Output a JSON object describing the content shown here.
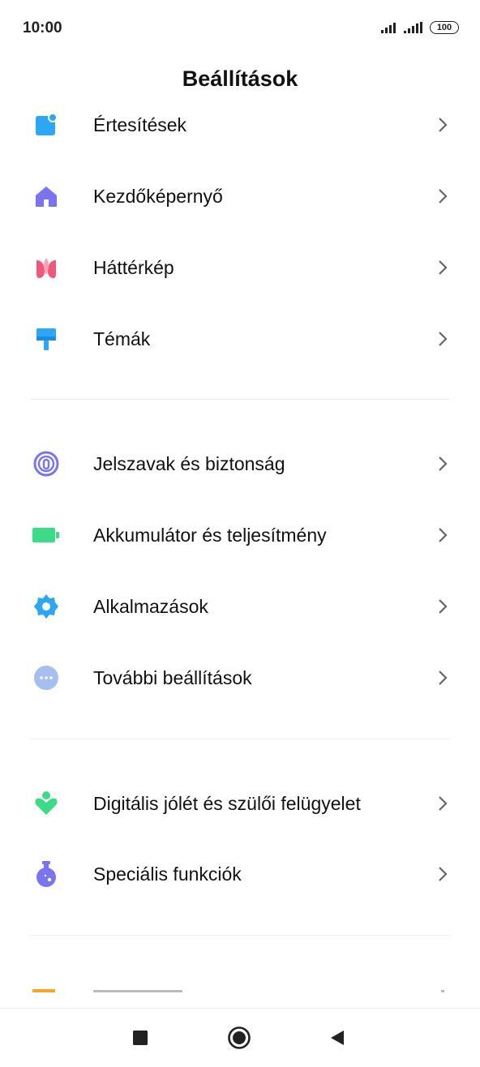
{
  "status_bar": {
    "time": "10:00",
    "battery": "100"
  },
  "header": {
    "title": "Beállítások"
  },
  "sections": [
    {
      "items": [
        {
          "label": "Értesítések",
          "icon": "notification-icon",
          "color": "#2ea6f6"
        },
        {
          "label": "Kezdőképernyő",
          "icon": "home-icon",
          "color": "#7b74f0"
        },
        {
          "label": "Háttérkép",
          "icon": "tulip-icon",
          "color": "#f0577a"
        },
        {
          "label": "Témák",
          "icon": "paint-roller-icon",
          "color": "#2ea6f6"
        }
      ]
    },
    {
      "items": [
        {
          "label": "Jelszavak és biztonság",
          "icon": "fingerprint-icon",
          "color": "#7b74f0"
        },
        {
          "label": "Akkumulátor és teljesítmény",
          "icon": "battery-icon",
          "color": "#3ddb87"
        },
        {
          "label": "Alkalmazások",
          "icon": "gear-icon",
          "color": "#2ea6f6"
        },
        {
          "label": "További beállítások",
          "icon": "more-dots-icon",
          "color": "#a6bff0"
        }
      ]
    },
    {
      "items": [
        {
          "label": "Digitális jólét és szülői felügyelet",
          "icon": "wellbeing-heart-icon",
          "color": "#3ddb87"
        },
        {
          "label": "Speciális funkciók",
          "icon": "flask-icon",
          "color": "#7b74f0"
        }
      ]
    }
  ],
  "navigation": {
    "recents": "recents-square-icon",
    "home": "home-circle-icon",
    "back": "back-triangle-icon"
  }
}
